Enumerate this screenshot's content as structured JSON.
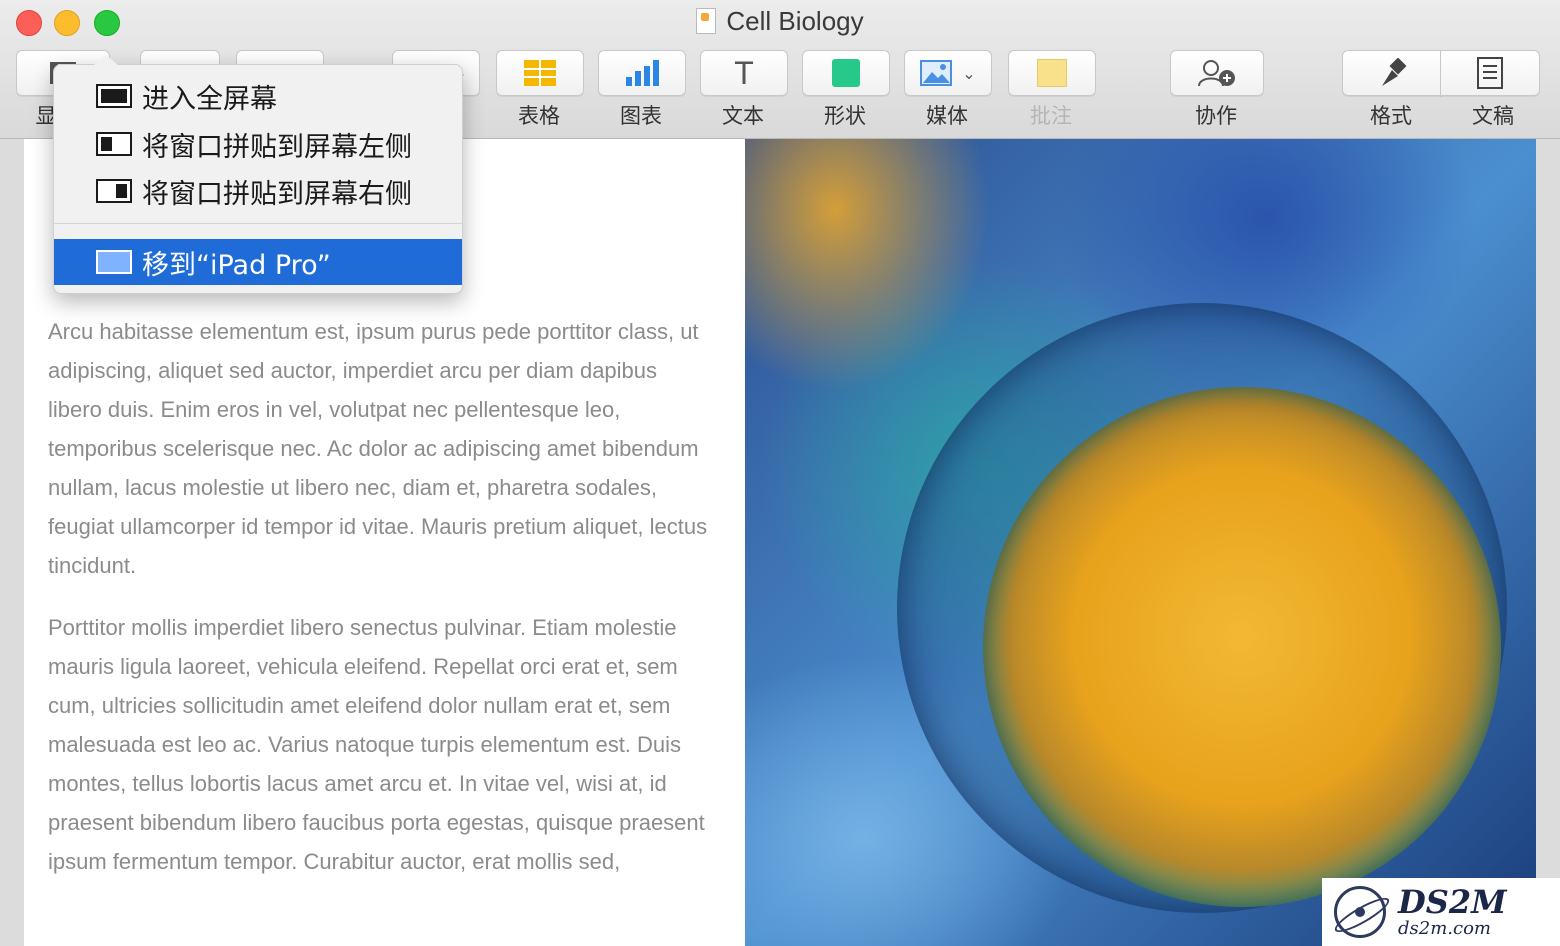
{
  "window": {
    "title": "Cell Biology"
  },
  "toolbar": {
    "items": [
      {
        "label": "显",
        "icon": "view-icon"
      },
      {
        "label": "表格",
        "icon": "table-icon"
      },
      {
        "label": "图表",
        "icon": "chart-icon"
      },
      {
        "label": "文本",
        "icon": "text-icon"
      },
      {
        "label": "形状",
        "icon": "shape-icon"
      },
      {
        "label": "媒体",
        "icon": "media-icon"
      },
      {
        "label": "批注",
        "icon": "comment-icon"
      },
      {
        "label": "协作",
        "icon": "collaborate-icon"
      },
      {
        "label": "格式",
        "icon": "format-icon"
      },
      {
        "label": "文稿",
        "icon": "document-icon"
      }
    ],
    "colors": {
      "table": "#f5b800",
      "chart": "#2b86e5",
      "shape": "#27c98a",
      "media": "#4a90e2",
      "comment": "#f9e08a"
    }
  },
  "menu": {
    "items": [
      {
        "label": "进入全屏幕",
        "icon": "fullscreen-icon"
      },
      {
        "label": "将窗口拼贴到屏幕左侧",
        "icon": "tile-left-icon"
      },
      {
        "label": "将窗口拼贴到屏幕右侧",
        "icon": "tile-right-icon"
      },
      {
        "label": "移到“iPad Pro”",
        "icon": "ipad-icon",
        "selected": true
      }
    ],
    "accent": "#1f6bd8"
  },
  "document": {
    "paragraphs": [
      "Arcu habitasse elementum est, ipsum purus pede porttitor class, ut adipiscing, aliquet sed auctor, imperdiet arcu per diam dapibus libero duis. Enim eros in vel, volutpat nec pellentesque leo, temporibus scelerisque nec. Ac dolor ac adipiscing amet bibendum nullam, lacus molestie ut libero nec, diam et, pharetra sodales, feugiat ullamcorper id tempor id vitae. Mauris pretium aliquet, lectus tincidunt.",
      "Porttitor mollis imperdiet libero senectus pulvinar. Etiam molestie mauris ligula laoreet, vehicula eleifend. Repellat orci erat et, sem cum, ultricies sollicitudin amet eleifend dolor nullam erat et, sem malesuada est leo ac. Varius natoque turpis elementum est. Duis montes, tellus lobortis lacus amet arcu et. In vitae vel, wisi at, id praesent bibendum libero faucibus porta egestas, quisque praesent ipsum fermentum tempor. Curabitur auctor, erat mollis sed,"
    ]
  },
  "watermark": {
    "main": "DS2M",
    "sub": "ds2m.com"
  }
}
